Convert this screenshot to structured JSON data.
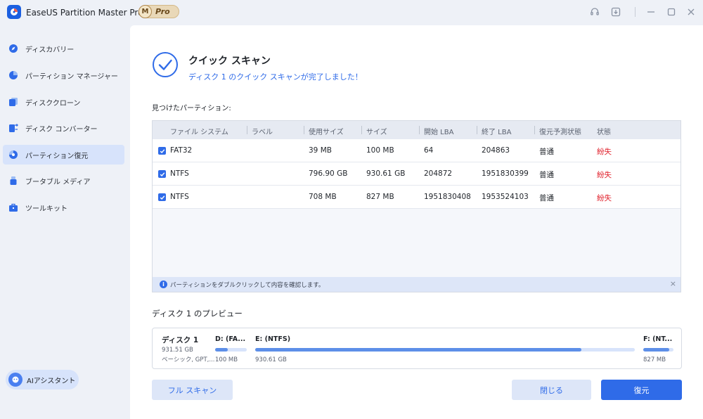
{
  "window": {
    "title": "EaseUS Partition Master Pro版",
    "badge_letter": "M",
    "badge_text": "Pro",
    "icons": [
      "headset-icon",
      "download-icon",
      "minimize-icon",
      "maximize-icon",
      "close-icon"
    ]
  },
  "sidebar": {
    "items": [
      {
        "label": "ディスカバリー",
        "icon": "discover-icon",
        "active": false
      },
      {
        "label": "パーティション マネージャー",
        "icon": "pie-chart-icon",
        "active": false
      },
      {
        "label": "ディスククローン",
        "icon": "clone-icon",
        "active": false
      },
      {
        "label": "ディスク コンバーター",
        "icon": "converter-icon",
        "active": false
      },
      {
        "label": "パーティション復元",
        "icon": "recovery-icon",
        "active": true
      },
      {
        "label": "ブータブル メディア",
        "icon": "usb-icon",
        "active": false
      },
      {
        "label": "ツールキット",
        "icon": "toolkit-icon",
        "active": false
      }
    ],
    "assistant_label": "AIアシスタント"
  },
  "main": {
    "title": "クイック スキャン",
    "subtitle": "ディスク 1 のクイック スキャンが完了しました！",
    "found_label": "見つけたパーティション:",
    "table": {
      "headers": [
        "ファイル システム",
        "ラベル",
        "使用サイズ",
        "サイズ",
        "開始 LBA",
        "終了 LBA",
        "復元予測状態",
        "状態"
      ],
      "rows": [
        {
          "checked": true,
          "fs": "FAT32",
          "label": "",
          "used": "39 MB",
          "size": "100 MB",
          "start": "64",
          "end": "204863",
          "prediction": "普通",
          "status": "紛失"
        },
        {
          "checked": true,
          "fs": "NTFS",
          "label": "",
          "used": "796.90 GB",
          "size": "930.61 GB",
          "start": "204872",
          "end": "1951830399",
          "prediction": "普通",
          "status": "紛失"
        },
        {
          "checked": true,
          "fs": "NTFS",
          "label": "",
          "used": "708 MB",
          "size": "827 MB",
          "start": "1951830408",
          "end": "1953524103",
          "prediction": "普通",
          "status": "紛失"
        }
      ]
    },
    "info_text": "パーティションをダブルクリックして内容を確認します。",
    "preview": {
      "title": "ディスク 1 のプレビュー",
      "disk_name": "ディスク 1",
      "disk_size": "931.51 GB",
      "disk_type": "ベーシック, GPT,...",
      "partitions": [
        {
          "label": "D: (FA...",
          "size": "100 MB",
          "used_fraction": 0.39
        },
        {
          "label": "E: (NTFS)",
          "size": "930.61 GB",
          "used_fraction": 0.86
        },
        {
          "label": "F: (NT...",
          "size": "827 MB",
          "used_fraction": 0.86
        }
      ]
    },
    "buttons": {
      "full_scan": "フル スキャン",
      "close": "閉じる",
      "restore": "復元"
    }
  },
  "colors": {
    "accent": "#2f6be8",
    "lost": "#e0202b",
    "active_nav": "#d7e3fb"
  }
}
